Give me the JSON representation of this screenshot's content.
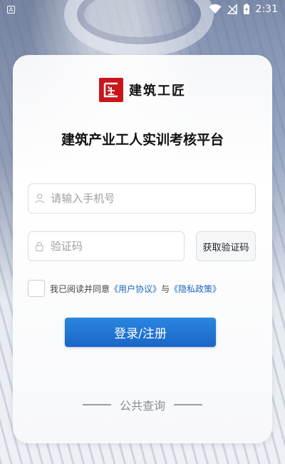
{
  "status_bar": {
    "notification_icon_label": "A",
    "time": "2:31",
    "icons": [
      "wifi-icon",
      "signal-off-icon",
      "battery-charging-icon"
    ]
  },
  "brand": {
    "logo_text": "建筑工匠",
    "logo_color": "#c9161b"
  },
  "app_title": "建筑产业工人实训考核平台",
  "form": {
    "phone_placeholder": "请输入手机号",
    "code_placeholder": "验证码",
    "get_code_label": "获取验证码",
    "agreement": {
      "prefix": "我已阅读并同意",
      "user_agreement": "《用户协议》",
      "joiner": "与",
      "privacy_policy": "《隐私政策》"
    },
    "login_label": "登录/注册",
    "accent_color": "#1a66c6"
  },
  "footer": {
    "public_query_label": "公共查询"
  }
}
